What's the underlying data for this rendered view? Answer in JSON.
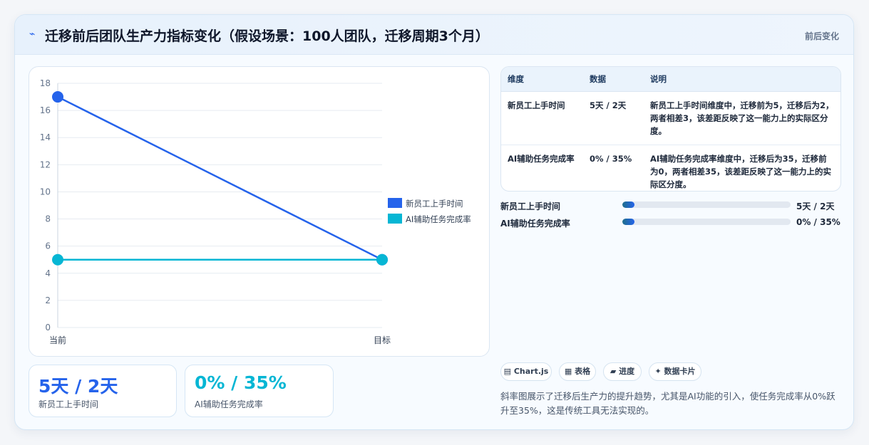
{
  "header": {
    "icon": "lightning-icon",
    "title": "迁移前后团队生产力指标变化（假设场景：100人团队，迁移周期3个月）",
    "badge": "前后变化"
  },
  "chart_data": {
    "type": "line",
    "categories": [
      "当前",
      "目标"
    ],
    "series": [
      {
        "name": "新员工上手时间",
        "values": [
          17,
          5
        ],
        "color": "#2563eb"
      },
      {
        "name": "AI辅助任务完成率",
        "values": [
          5,
          5
        ],
        "color": "#06b6d4"
      }
    ],
    "ylim": [
      0,
      18
    ],
    "yticks": [
      0,
      2,
      4,
      6,
      8,
      10,
      12,
      14,
      16,
      18
    ],
    "grid": true,
    "legend": "right"
  },
  "stats": [
    {
      "value": "5天 / 2天",
      "label": "新员工上手时间",
      "color": "#2563eb"
    },
    {
      "value": "0% / 35%",
      "label": "AI辅助任务完成率",
      "color": "#06b6d4"
    }
  ],
  "table": {
    "headers": [
      "维度",
      "数据",
      "说明"
    ],
    "rows": [
      [
        "新员工上手时间",
        "5天 / 2天",
        "新员工上手时间维度中，迁移前为5，迁移后为2，两者相差3，该差距反映了这一能力上的实际区分度。"
      ],
      [
        "AI辅助任务完成率",
        "0% / 35%",
        "AI辅助任务完成率维度中，迁移后为35，迁移前为0，两者相差35，该差距反映了这一能力上的实际区分度。"
      ]
    ]
  },
  "progress": [
    {
      "label": "新员工上手时间",
      "value": "5天 / 2天",
      "fill_fraction": 0.07
    },
    {
      "label": "AI辅助任务完成率",
      "value": "0% / 35%",
      "fill_fraction": 0.07
    }
  ],
  "chips": [
    {
      "icon": "chart-icon",
      "label": "▤ Chart.js"
    },
    {
      "icon": "table-icon",
      "label": "▦ 表格"
    },
    {
      "icon": "progress-icon",
      "label": "▰ 进度"
    },
    {
      "icon": "sparkle-icon",
      "label": "✦ 数据卡片"
    }
  ],
  "note": "斜率图展示了迁移后生产力的提升趋势，尤其是AI功能的引入，使任务完成率从0%跃升至35%，这是传统工具无法实现的。"
}
